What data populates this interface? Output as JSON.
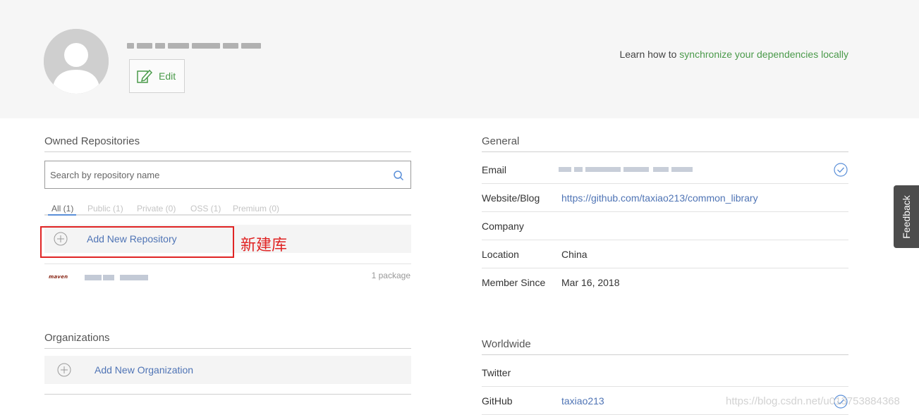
{
  "header": {
    "edit_label": "Edit",
    "learn_prefix": "Learn how to ",
    "learn_link": "synchronize your dependencies locally"
  },
  "owned": {
    "title": "Owned Repositories",
    "search_placeholder": "Search by repository name",
    "tabs": [
      {
        "label": "All (1)",
        "active": true
      },
      {
        "label": "Public (1)",
        "active": false
      },
      {
        "label": "Private (0)",
        "active": false
      },
      {
        "label": "OSS (1)",
        "active": false
      },
      {
        "label": "Premium (0)",
        "active": false
      }
    ],
    "add_label": "Add New Repository",
    "annotation": "新建库",
    "package": {
      "logo": "maven",
      "count": "1 package"
    }
  },
  "organizations": {
    "title": "Organizations",
    "add_label": "Add New Organization"
  },
  "general": {
    "title": "General",
    "fields": [
      {
        "label": "Email",
        "value": ""
      },
      {
        "label": "Website/Blog",
        "value": "https://github.com/taxiao213/common_library"
      },
      {
        "label": "Company",
        "value": ""
      },
      {
        "label": "Location",
        "value": "China"
      },
      {
        "label": "Member Since",
        "value": "Mar 16, 2018"
      }
    ]
  },
  "worldwide": {
    "title": "Worldwide",
    "fields": [
      {
        "label": "Twitter",
        "value": ""
      },
      {
        "label": "GitHub",
        "value": "taxiao213"
      }
    ]
  },
  "feedback_label": "Feedback",
  "watermark": "https://blog.csdn.net/u013753884368",
  "colors": {
    "header_bg": "#f6f6f6",
    "link_blue": "#4f74b5",
    "link_green": "#4a9a4a",
    "annotation_red": "#e02424",
    "feedback_bg": "#4c4c4c"
  }
}
